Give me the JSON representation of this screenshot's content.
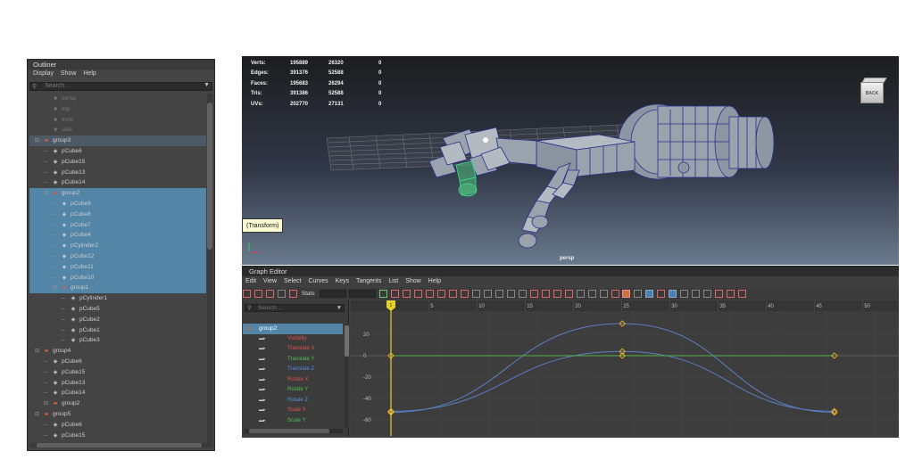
{
  "outliner": {
    "title": "Outliner",
    "menu": [
      "Display",
      "Show",
      "Help"
    ],
    "search_placeholder": "Search...",
    "items": [
      {
        "label": "persp",
        "type": "camera",
        "depth": 1,
        "selected": false
      },
      {
        "label": "top",
        "type": "camera",
        "depth": 1,
        "selected": false
      },
      {
        "label": "front",
        "type": "camera",
        "depth": 1,
        "selected": false
      },
      {
        "label": "side",
        "type": "camera",
        "depth": 1,
        "selected": false
      },
      {
        "label": "group3",
        "type": "group",
        "depth": 0,
        "selected": false,
        "highlight": true
      },
      {
        "label": "pCube6",
        "type": "mesh",
        "depth": 1,
        "selected": false
      },
      {
        "label": "pCube15",
        "type": "mesh",
        "depth": 1,
        "selected": false
      },
      {
        "label": "pCube13",
        "type": "mesh",
        "depth": 1,
        "selected": false
      },
      {
        "label": "pCube14",
        "type": "mesh",
        "depth": 1,
        "selected": false
      },
      {
        "label": "group2",
        "type": "group",
        "depth": 1,
        "selected": true
      },
      {
        "label": "pCube9",
        "type": "mesh",
        "depth": 2,
        "selected": true
      },
      {
        "label": "pCube8",
        "type": "mesh",
        "depth": 2,
        "selected": true
      },
      {
        "label": "pCube7",
        "type": "mesh",
        "depth": 2,
        "selected": true
      },
      {
        "label": "pCube4",
        "type": "mesh",
        "depth": 2,
        "selected": true
      },
      {
        "label": "pCylinder2",
        "type": "mesh",
        "depth": 2,
        "selected": true
      },
      {
        "label": "pCube12",
        "type": "mesh",
        "depth": 2,
        "selected": true
      },
      {
        "label": "pCube11",
        "type": "mesh",
        "depth": 2,
        "selected": true
      },
      {
        "label": "pCube10",
        "type": "mesh",
        "depth": 2,
        "selected": true
      },
      {
        "label": "group1",
        "type": "group",
        "depth": 2,
        "selected": true
      },
      {
        "label": "pCylinder1",
        "type": "mesh",
        "depth": 3,
        "selected": false
      },
      {
        "label": "pCube5",
        "type": "mesh",
        "depth": 3,
        "selected": false
      },
      {
        "label": "pCube2",
        "type": "mesh",
        "depth": 3,
        "selected": false
      },
      {
        "label": "pCube1",
        "type": "mesh",
        "depth": 3,
        "selected": false
      },
      {
        "label": "pCube3",
        "type": "mesh",
        "depth": 3,
        "selected": false
      },
      {
        "label": "group4",
        "type": "group",
        "depth": 0,
        "selected": false
      },
      {
        "label": "pCube6",
        "type": "mesh",
        "depth": 1,
        "selected": false
      },
      {
        "label": "pCube15",
        "type": "mesh",
        "depth": 1,
        "selected": false
      },
      {
        "label": "pCube13",
        "type": "mesh",
        "depth": 1,
        "selected": false
      },
      {
        "label": "pCube14",
        "type": "mesh",
        "depth": 1,
        "selected": false
      },
      {
        "label": "group2",
        "type": "group",
        "depth": 1,
        "selected": false
      },
      {
        "label": "group5",
        "type": "group",
        "depth": 0,
        "selected": false
      },
      {
        "label": "pCube6",
        "type": "mesh",
        "depth": 1,
        "selected": false
      },
      {
        "label": "pCube15",
        "type": "mesh",
        "depth": 1,
        "selected": false
      }
    ]
  },
  "viewport": {
    "hud": [
      {
        "label": "Verts:",
        "v1": "195889",
        "v2": "26320",
        "v3": "0"
      },
      {
        "label": "Edges:",
        "v1": "391376",
        "v2": "52588",
        "v3": "0"
      },
      {
        "label": "Faces:",
        "v1": "195683",
        "v2": "26294",
        "v3": "0"
      },
      {
        "label": "Tris:",
        "v1": "391386",
        "v2": "52588",
        "v3": "0"
      },
      {
        "label": "UVs:",
        "v1": "202770",
        "v2": "27131",
        "v3": "0"
      }
    ],
    "viewcube_label": "BACK",
    "tooltip": "(Transform)",
    "camera_label": "persp",
    "colors": {
      "wire": "#2a2f8a",
      "mesh": "#9aa3ad",
      "selected": "#38e08a",
      "grid": "#8a8a8a"
    }
  },
  "graph_editor": {
    "title": "Graph Editor",
    "menu": [
      "Edit",
      "View",
      "Select",
      "Curves",
      "Keys",
      "Tangents",
      "List",
      "Show",
      "Help"
    ],
    "stats_label": "Stats",
    "search_placeholder": "Search...",
    "node": "group2",
    "attributes": [
      {
        "label": "Visibility",
        "color": "#e05050"
      },
      {
        "label": "Translate X",
        "color": "#e05050"
      },
      {
        "label": "Translate Y",
        "color": "#50c050"
      },
      {
        "label": "Translate Z",
        "color": "#5a8ae0"
      },
      {
        "label": "Rotate X",
        "color": "#e05050"
      },
      {
        "label": "Rotate Y",
        "color": "#50c050"
      },
      {
        "label": "Rotate Z",
        "color": "#5a8ae0"
      },
      {
        "label": "Scale X",
        "color": "#e05050"
      },
      {
        "label": "Scale Y",
        "color": "#50c050"
      }
    ],
    "current_frame": "1",
    "time_ticks": [
      "5",
      "10",
      "15",
      "20",
      "25",
      "30",
      "35",
      "40",
      "45",
      "50"
    ],
    "value_ticks": [
      "20",
      "0",
      "-20",
      "-40",
      "-60"
    ],
    "colors": {
      "curve_blue": "#5b7fc2",
      "curve_green": "#58b04a",
      "key": "#f0b020",
      "playhead": "#e6d02a"
    }
  },
  "chart_data": {
    "type": "line",
    "xlabel": "",
    "ylabel": "",
    "xlim": [
      0,
      50
    ],
    "ylim": [
      -65,
      35
    ],
    "series": [
      {
        "color": "#5b7fc2",
        "keys": [
          [
            1,
            -53
          ],
          [
            25,
            30
          ],
          [
            47,
            -53
          ]
        ]
      },
      {
        "color": "#5b7fc2",
        "keys": [
          [
            1,
            -52
          ],
          [
            25,
            4
          ],
          [
            47,
            -52
          ]
        ]
      },
      {
        "color": "#58b04a",
        "keys": [
          [
            1,
            0
          ],
          [
            25,
            0
          ],
          [
            47,
            0
          ]
        ]
      }
    ]
  }
}
